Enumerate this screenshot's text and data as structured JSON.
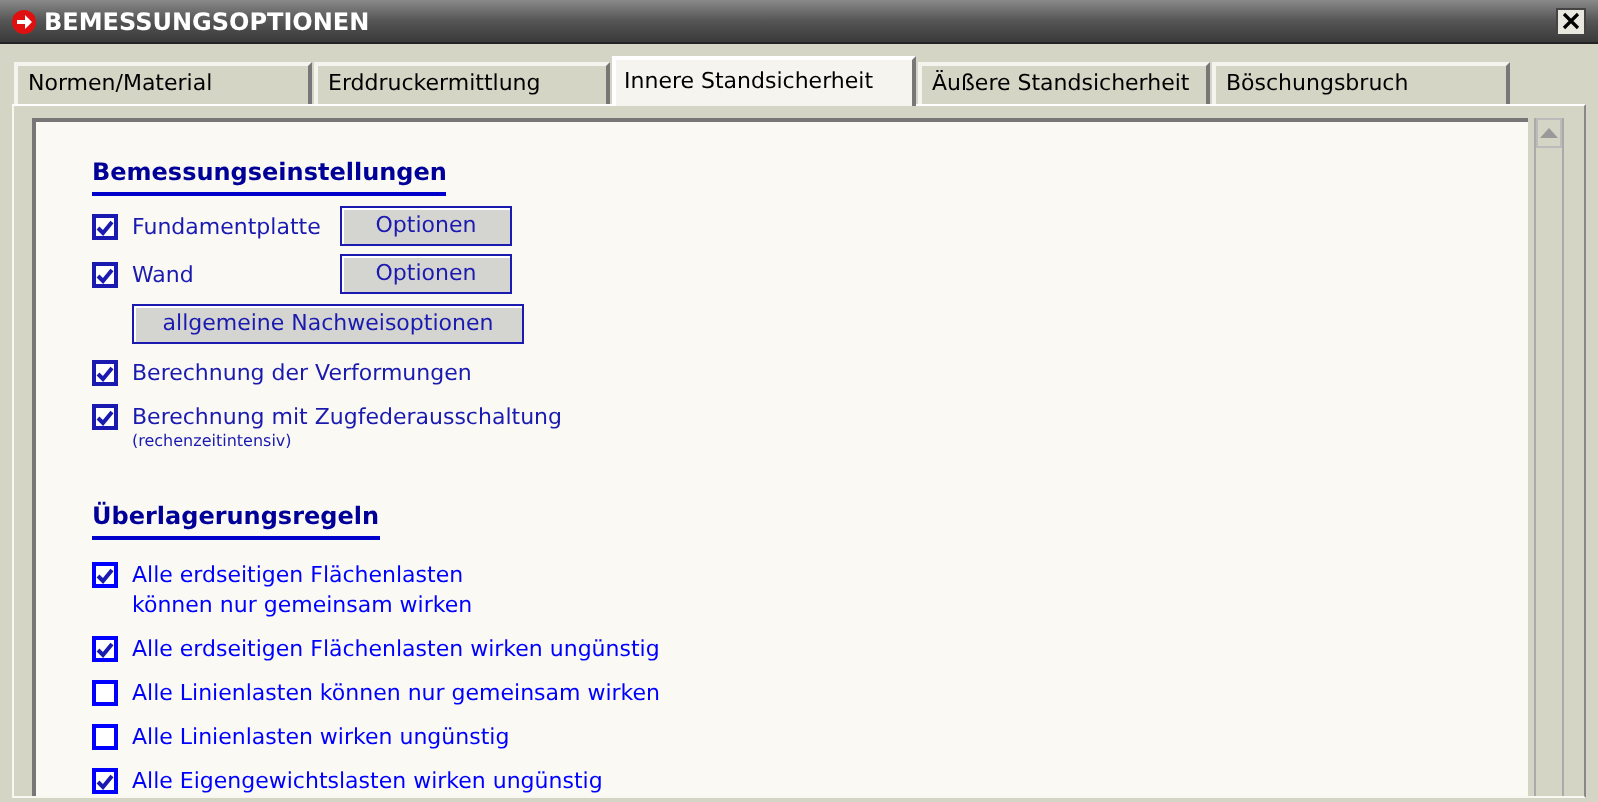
{
  "window": {
    "title": "BEMESSUNGSOPTIONEN"
  },
  "tabs": [
    {
      "label": "Normen/Material",
      "selected": false
    },
    {
      "label": "Erddruckermittlung",
      "selected": false
    },
    {
      "label": "Innere Standsicherheit",
      "selected": true
    },
    {
      "label": "Äußere Standsicherheit",
      "selected": false
    },
    {
      "label": "Böschungsbruch",
      "selected": false
    }
  ],
  "sections": [
    {
      "heading": "Bemessungseinstellungen",
      "items": [
        {
          "kind": "checkbox",
          "label": "Fundamentplatte",
          "checked": true,
          "button": "Optionen"
        },
        {
          "kind": "checkbox",
          "label": "Wand",
          "checked": true,
          "button": "Optionen"
        },
        {
          "kind": "button",
          "label": "allgemeine Nachweisoptionen"
        },
        {
          "kind": "checkbox",
          "label": "Berechnung der Verformungen",
          "checked": true
        },
        {
          "kind": "checkbox",
          "label": "Berechnung mit Zugfederausschaltung",
          "checked": true,
          "note": "(rechenzeitintensiv)"
        }
      ]
    },
    {
      "heading": "Überlagerungsregeln",
      "items": [
        {
          "kind": "checkbox",
          "label": "Alle erdseitigen Flächenlasten\nkönnen nur gemeinsam wirken",
          "checked": true
        },
        {
          "kind": "checkbox",
          "label": "Alle erdseitigen Flächenlasten wirken ungünstig",
          "checked": true
        },
        {
          "kind": "checkbox",
          "label": "Alle Linienlasten können nur gemeinsam wirken",
          "checked": false
        },
        {
          "kind": "checkbox",
          "label": "Alle Linienlasten wirken ungünstig",
          "checked": false
        },
        {
          "kind": "checkbox",
          "label": "Alle Eigengewichtslasten wirken ungünstig",
          "checked": true
        }
      ]
    }
  ]
}
